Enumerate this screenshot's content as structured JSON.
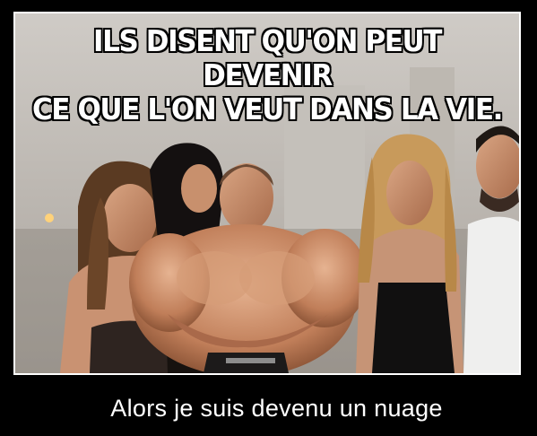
{
  "meme": {
    "top_caption": {
      "line1": "ILS DISENT QU'ON PEUT DEVENIR",
      "line2": "CE QUE L'ON VEUT DANS LA VIE."
    },
    "bottom_caption": "Alors je suis devenu un nuage"
  },
  "colors": {
    "background": "#000000",
    "frame_border": "#ffffff",
    "caption_text": "#ffffff"
  }
}
